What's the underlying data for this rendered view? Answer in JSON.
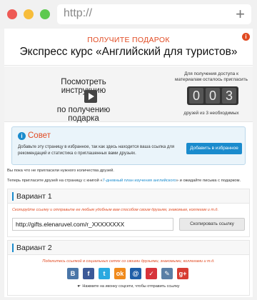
{
  "browser": {
    "url": "http://"
  },
  "header": {
    "subtitle": "ПОЛУЧИТЕ ПОДАРОК",
    "title": "Экспресс курс «Английский для туристов»"
  },
  "video": {
    "line1": "Посмотреть инструкцию",
    "line2": "по получению подарка"
  },
  "counter": {
    "top_text": "Для получения доступа к материалам осталось пригласить",
    "digits": [
      "0",
      "0",
      "3"
    ],
    "bottom_text": "друзей из 3 необходимых"
  },
  "advice": {
    "title": "Совет",
    "text": "Добавьте эту страницу в избранное, так как здесь находится ваша ссылка для рекомендаций и статистика о приглашенных вами друзьях.",
    "button": "Добавить в избранное"
  },
  "notes": {
    "line1": "Вы пока что не пригласили нужного количества друзей.",
    "line2_before": "Теперь пригласите друзей на страницу с книгой «",
    "line2_link": "7-дневный план изучения английского",
    "line2_after": "» и ожидайте письма с подарком."
  },
  "variant1": {
    "title": "Вариант 1",
    "hint": "Скопируйте ссылку и отправьте ее любым удобным вам способом своим друзьям, знакомым, коллегам и т.д.",
    "link_value": "http://gifts.elenaruvel.com/r_XXXXXXXX",
    "copy_button": "Скопировать ссылку"
  },
  "variant2": {
    "title": "Вариант 2",
    "hint": "Поделитесь ссылкой в социальных сетях со своими друзьями, знакомыми, коллегами и т.д.",
    "socials": [
      {
        "name": "vkontakte-icon",
        "glyph": "B",
        "color": "#4a76a8"
      },
      {
        "name": "facebook-icon",
        "glyph": "f",
        "color": "#3b5998"
      },
      {
        "name": "twitter-icon",
        "glyph": "t",
        "color": "#2aa9e0"
      },
      {
        "name": "odnoklassniki-icon",
        "glyph": "ok",
        "color": "#f08a1c"
      },
      {
        "name": "moimir-icon",
        "glyph": "@",
        "color": "#1f5ea8"
      },
      {
        "name": "runner-icon",
        "glyph": "✓",
        "color": "#d7333a"
      },
      {
        "name": "livejournal-icon",
        "glyph": "✎",
        "color": "#5a7fa6"
      },
      {
        "name": "googleplus-icon",
        "glyph": "g+",
        "color": "#d73d32"
      }
    ],
    "share_note": "Нажмите на иконку соцсети, чтобы отправить ссылку"
  }
}
